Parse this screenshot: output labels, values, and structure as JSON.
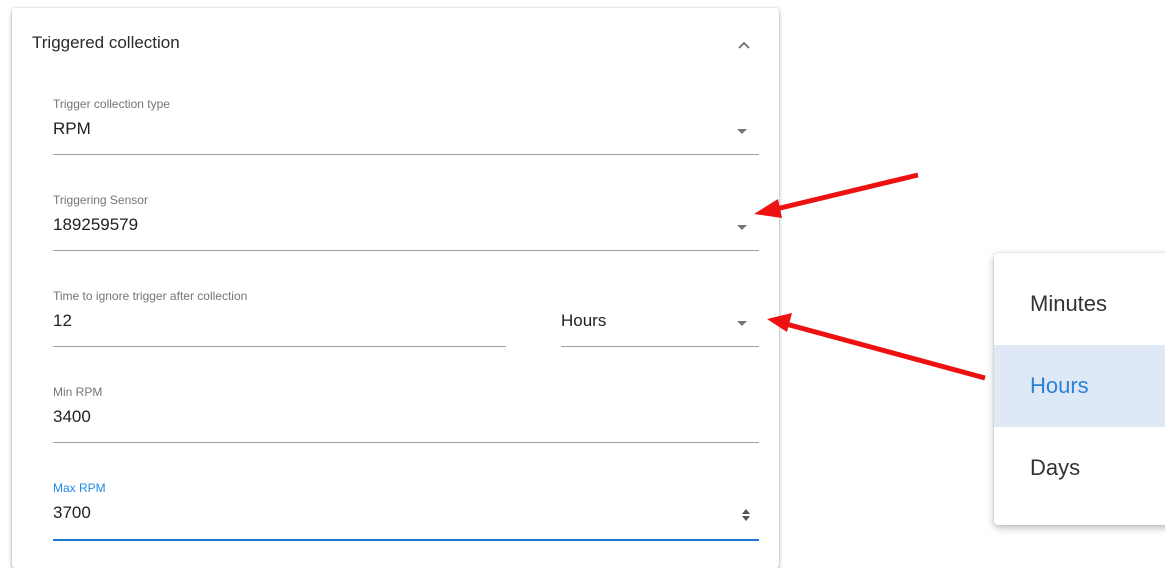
{
  "panel": {
    "title": "Triggered collection"
  },
  "fields": {
    "trigger_type": {
      "label": "Trigger collection type",
      "value": "RPM"
    },
    "triggering_sensor": {
      "label": "Triggering Sensor",
      "value": "189259579"
    },
    "ignore_time": {
      "label": "Time to ignore trigger after collection",
      "value": "12"
    },
    "ignore_unit": {
      "value": "Hours"
    },
    "min_rpm": {
      "label": "Min RPM",
      "value": "3400"
    },
    "max_rpm": {
      "label": "Max RPM",
      "value": "3700"
    }
  },
  "unit_dropdown": {
    "options": [
      "Minutes",
      "Hours",
      "Days"
    ],
    "selected": "Hours"
  },
  "colors": {
    "accent": "#1976d2",
    "annotation_arrow": "#ee1111",
    "selected_bg": "#dfe9f6"
  }
}
